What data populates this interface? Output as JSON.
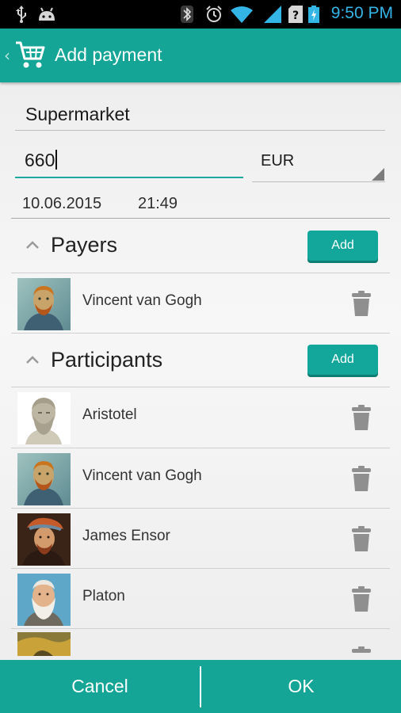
{
  "status_bar": {
    "time": "9:50 PM",
    "icons": [
      "usb-icon",
      "android-icon",
      "bluetooth-icon",
      "alarm-icon",
      "wifi-icon",
      "signal-icon",
      "sim-unknown-icon",
      "battery-charging-icon"
    ]
  },
  "action_bar": {
    "title": "Add payment",
    "icon": "shopping-cart-icon"
  },
  "form": {
    "description_value": "Supermarket",
    "amount_value": "660",
    "currency_selected": "EUR",
    "date": "10.06.2015",
    "time": "21:49"
  },
  "payers": {
    "title": "Payers",
    "add_label": "Add",
    "items": [
      {
        "name": "Vincent van Gogh"
      }
    ]
  },
  "participants": {
    "title": "Participants",
    "add_label": "Add",
    "items": [
      {
        "name": "Aristotel"
      },
      {
        "name": "Vincent van Gogh"
      },
      {
        "name": "James Ensor"
      },
      {
        "name": "Platon"
      }
    ]
  },
  "bottom_bar": {
    "cancel_label": "Cancel",
    "ok_label": "OK"
  },
  "colors": {
    "accent": "#14a596",
    "status_time": "#33b5e5"
  }
}
